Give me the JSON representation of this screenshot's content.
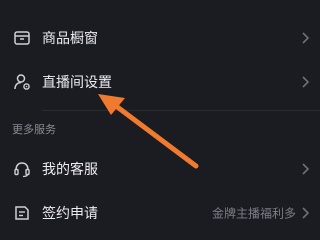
{
  "menu": {
    "showcase": {
      "label": "商品橱窗",
      "icon": "storefront-icon"
    },
    "live_room_settings": {
      "label": "直播间设置",
      "icon": "user-settings-icon"
    }
  },
  "more_services": {
    "title": "更多服务",
    "customer_service": {
      "label": "我的客服",
      "icon": "headset-icon"
    },
    "contract_application": {
      "label": "签约申请",
      "icon": "contract-icon",
      "extra": "金牌主播福利多"
    }
  },
  "annotation": {
    "type": "arrow",
    "color": "#f07a2e"
  },
  "colors": {
    "background": "#1b1b22",
    "text": "#ececf1",
    "secondary_text": "#7d7d87",
    "chevron": "#6f6f78"
  }
}
